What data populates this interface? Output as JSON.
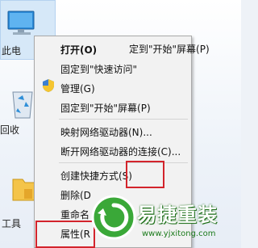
{
  "desktop": {
    "icons": [
      {
        "name": "pc",
        "label": "此电"
      },
      {
        "name": "recycle",
        "label": "回收"
      },
      {
        "name": "tools",
        "label": "工具"
      }
    ]
  },
  "menu": {
    "items": [
      {
        "key": "open",
        "label": "打开(O)",
        "bold": true
      },
      {
        "key": "pin_quick",
        "label": "固定到\"快速访问\""
      },
      {
        "key": "manage",
        "label": "管理(G)"
      },
      {
        "key": "pin_start",
        "label": "固定到\"开始\"屏幕(P)"
      },
      {
        "key": "map_drive",
        "label": "映射网络驱动器(N)..."
      },
      {
        "key": "disconnect_drive",
        "label": "断开网络驱动器的连接(C)..."
      },
      {
        "key": "create_shortcut",
        "label": "创建快捷方式(S)"
      },
      {
        "key": "delete",
        "label": "删除(D"
      },
      {
        "key": "rename",
        "label": "重命名"
      },
      {
        "key": "properties",
        "label": "属性(R"
      }
    ],
    "partial_text": "定到\"开始\"屏幕(P)"
  },
  "watermark": {
    "brand": "易捷重装",
    "url": "www.yjxitong.com"
  },
  "colors": {
    "annotation_red": "#d3242c",
    "logo_green": "#3aa838"
  }
}
